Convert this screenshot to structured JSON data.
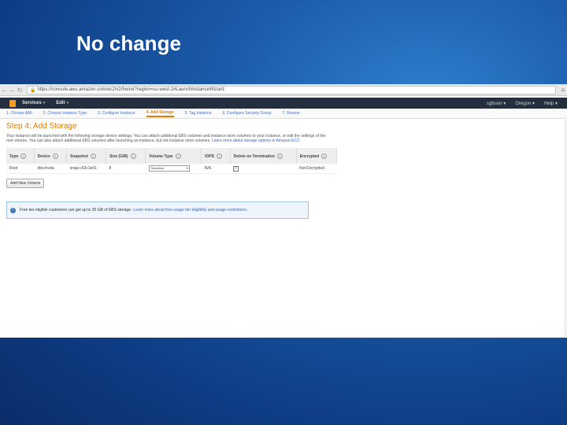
{
  "slide": {
    "title": "No change"
  },
  "browser": {
    "url": "https://console.aws.amazon.com/ec2/v2/home?region=us-west-2#LaunchInstanceWizard:",
    "back_glyph": "←",
    "forward_glyph": "→",
    "reload_glyph": "↻",
    "lock_glyph": "🔒",
    "menu_glyph": "≡"
  },
  "aws_nav": {
    "services": "Services",
    "edit": "Edit",
    "caret": "▾",
    "right_items": [
      "sgfuser ▾",
      "Oregon ▾",
      "Help ▾"
    ]
  },
  "wizard": {
    "steps": [
      "1. Choose AMI",
      "2. Choose Instance Type",
      "3. Configure Instance",
      "4. Add Storage",
      "5. Tag Instance",
      "6. Configure Security Group",
      "7. Review"
    ],
    "active_index": 3
  },
  "page": {
    "title": "Step 4: Add Storage",
    "description": "Your instance will be launched with the following storage device settings. You can attach additional EBS volumes and instance store volumes to your instance, or edit the settings of the root volume. You can also attach additional EBS volumes after launching an instance, but not instance store volumes.",
    "learn_more": "Learn more about storage options in Amazon EC2."
  },
  "table": {
    "headers": [
      "Type",
      "Device",
      "Snapshot",
      "Size (GiB)",
      "Volume Type",
      "IOPS",
      "Delete on Termination",
      "Encrypted"
    ],
    "info_glyph": "i",
    "rows": [
      {
        "type": "Root",
        "device": "/dev/xvda",
        "snapshot": "snap-c53c1e01",
        "size": "8",
        "volume_type": "Standard",
        "iops": "N/A",
        "delete_on_termination": "✓",
        "encrypted": "Not Encrypted"
      }
    ]
  },
  "add_volume_button": "Add New Volume",
  "notice": {
    "icon": "i",
    "text": "Free tier eligible customers can get up to 30 GB of EBS storage.",
    "link": "Learn more about free usage tier eligibility and usage restrictions."
  }
}
